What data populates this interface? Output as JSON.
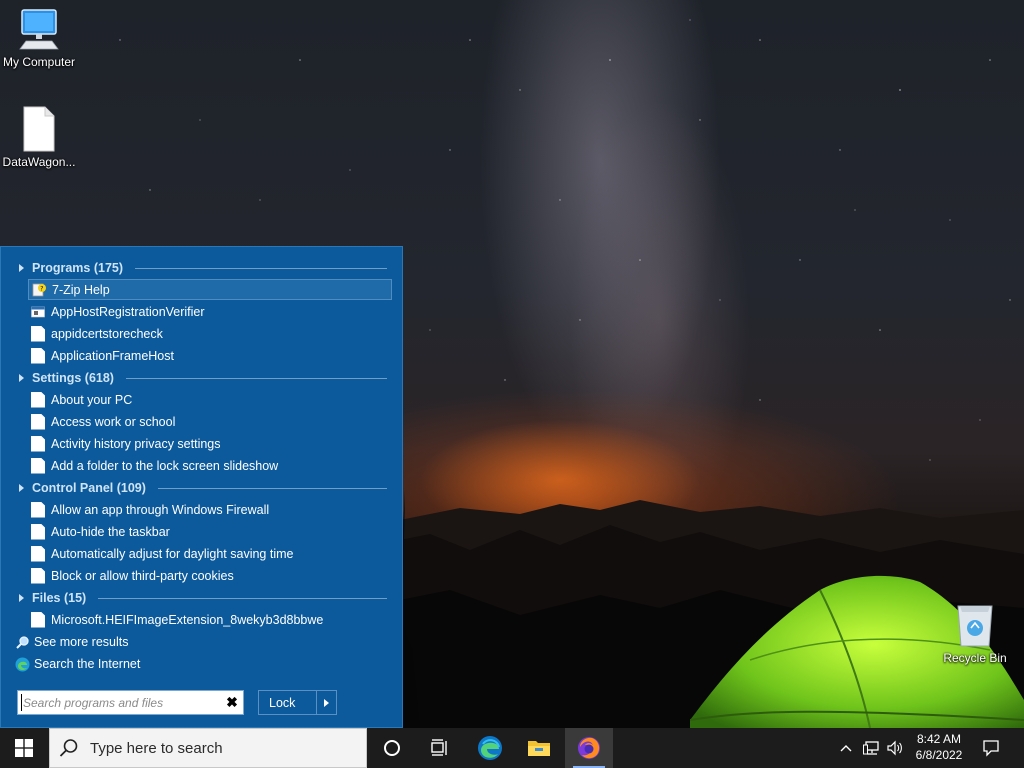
{
  "desktop": {
    "icons": [
      {
        "label": "My Computer"
      },
      {
        "label": "DataWagon..."
      },
      {
        "label": "Recycle Bin"
      }
    ]
  },
  "start_menu": {
    "sections": [
      {
        "title": "Programs (175)",
        "items": [
          "7-Zip Help",
          "AppHostRegistrationVerifier",
          "appidcertstorecheck",
          "ApplicationFrameHost"
        ]
      },
      {
        "title": "Settings (618)",
        "items": [
          "About your PC",
          "Access work or school",
          "Activity history privacy settings",
          "Add a folder to the lock screen slideshow"
        ]
      },
      {
        "title": "Control Panel (109)",
        "items": [
          "Allow an app through Windows Firewall",
          "Auto-hide the taskbar",
          "Automatically adjust for daylight saving time",
          "Block or allow third-party cookies"
        ]
      },
      {
        "title": "Files (15)",
        "items": [
          "Microsoft.HEIFImageExtension_8wekyb3d8bbwe"
        ]
      }
    ],
    "see_more": "See more results",
    "search_internet": "Search the Internet",
    "search": {
      "placeholder": "Search programs and files",
      "value": "",
      "clear_icon": "close-icon"
    },
    "power_button": {
      "label": "Lock"
    }
  },
  "taskbar": {
    "search_placeholder": "Type here to search",
    "apps": [
      "cortana",
      "task-view",
      "edge",
      "file-explorer",
      "firefox"
    ],
    "clock": {
      "time": "8:42 AM",
      "date": "6/8/2022"
    }
  },
  "colors": {
    "menu_bg": "#0c5a9c",
    "section_title": "#cfe4f7",
    "taskbar_bg": "#1c1c1c"
  }
}
